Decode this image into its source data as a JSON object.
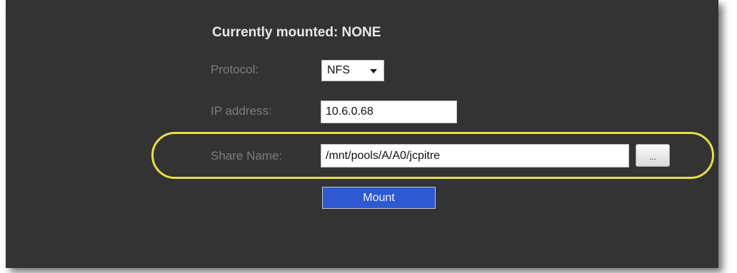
{
  "heading": "Currently mounted: NONE",
  "form": {
    "protocol_label": "Protocol:",
    "protocol_value": "NFS",
    "ip_label": "IP address:",
    "ip_value": "10.6.0.68",
    "share_label": "Share Name:",
    "share_value": "/mnt/pools/A/A0/jcpitre",
    "browse_label": "...",
    "mount_label": "Mount"
  },
  "colors": {
    "panel": "#333333",
    "highlight": "#e3e04a",
    "mount_button": "#2f59d2"
  }
}
